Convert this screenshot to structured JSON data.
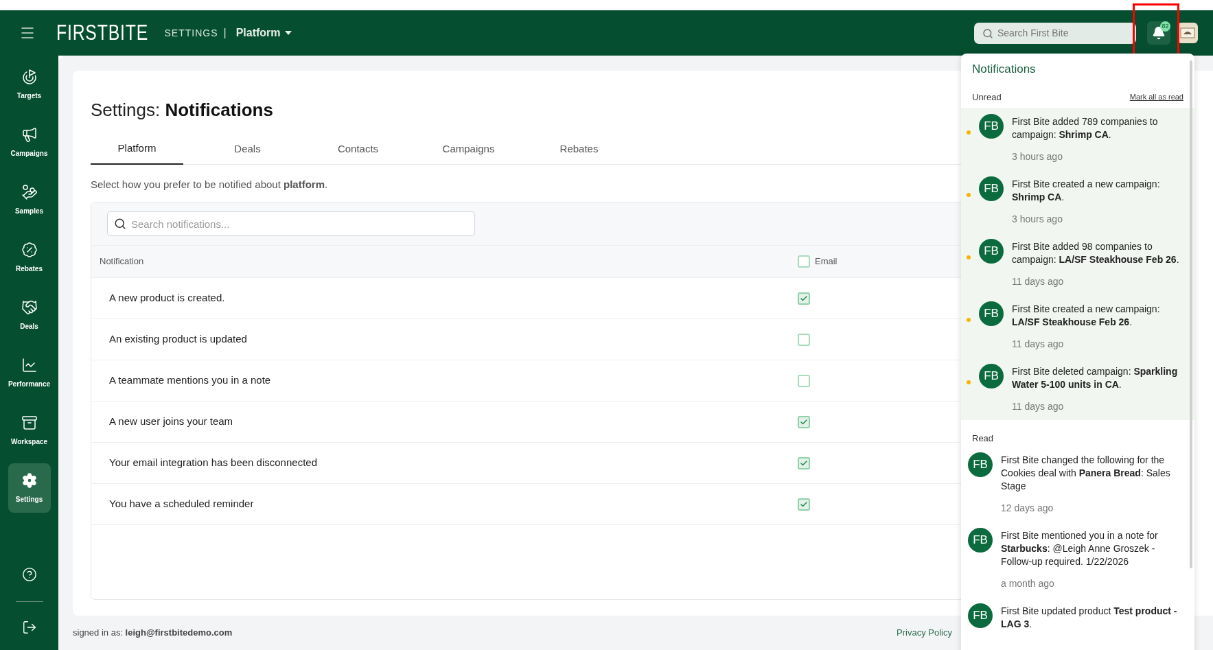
{
  "topbar": {
    "logo": "FIRST**BITE**",
    "section": "SETTINGS",
    "separator": "|",
    "dropdown": "Platform",
    "search": {
      "placeholder": "Search First Bite"
    },
    "badge": "82"
  },
  "sidebar": {
    "items": [
      {
        "label": "Targets",
        "selected": false
      },
      {
        "label": "Campaigns",
        "selected": false
      },
      {
        "label": "Samples",
        "selected": false
      },
      {
        "label": "Rebates",
        "selected": false
      },
      {
        "label": "Deals",
        "selected": false
      },
      {
        "label": "Performance",
        "selected": false
      },
      {
        "label": "Workspace",
        "selected": false
      },
      {
        "label": "Settings",
        "selected": true
      }
    ]
  },
  "page": {
    "title_prefix": "Settings:",
    "title": "Notifications",
    "tabs": [
      {
        "label": "Platform",
        "selected": true
      },
      {
        "label": "Deals",
        "selected": false
      },
      {
        "label": "Contacts",
        "selected": false
      },
      {
        "label": "Campaigns",
        "selected": false
      },
      {
        "label": "Rebates",
        "selected": false
      }
    ],
    "description": "Select how you prefer to be notified about **platform**.",
    "search": {
      "placeholder": "Search notifications..."
    },
    "table": {
      "columns": [
        "Notification",
        "Email"
      ],
      "email_all_checked": false,
      "rows": [
        {
          "label": "A new product is created.",
          "email_checked": true
        },
        {
          "label": "An existing product is updated",
          "email_checked": false
        },
        {
          "label": "A teammate mentions you in a note",
          "email_checked": false
        },
        {
          "label": "A new user joins your team",
          "email_checked": true
        },
        {
          "label": "Your email integration has been disconnected",
          "email_checked": true
        },
        {
          "label": "You have a scheduled reminder",
          "email_checked": true
        }
      ]
    }
  },
  "footer": {
    "signed_in": "signed in as: **leigh@firstbitedemo.com**",
    "privacy": "Privacy Policy"
  },
  "notifications": {
    "title": "Notifications",
    "unread_heading": "Unread",
    "mark_all": "Mark all as read",
    "read_heading": "Read",
    "items": [
      {
        "avatar": "FB",
        "unread": true,
        "text": "First Bite added 789 companies to campaign: **Shrimp CA**.",
        "time": "3 hours ago"
      },
      {
        "avatar": "FB",
        "unread": true,
        "text": "First Bite created a new campaign: **Shrimp CA**.",
        "time": "3 hours ago"
      },
      {
        "avatar": "FB",
        "unread": true,
        "text": "First Bite added 98 companies to campaign: **LA/SF Steakhouse Feb 26**.",
        "time": "11 days ago"
      },
      {
        "avatar": "FB",
        "unread": true,
        "text": "First Bite created a new campaign: **LA/SF Steakhouse Feb 26**.",
        "time": "11 days ago"
      },
      {
        "avatar": "FB",
        "unread": true,
        "text": "First Bite deleted campaign: **Sparkling Water 5-100 units in CA**.",
        "time": "11 days ago"
      },
      {
        "avatar": "FB",
        "unread": false,
        "text": "First Bite changed the following for the Cookies deal with **Panera Bread**: Sales Stage",
        "time": "12 days ago"
      },
      {
        "avatar": "FB",
        "unread": false,
        "text": "First Bite mentioned you in a note for **Starbucks**: @Leigh Anne Groszek - Follow-up required. 1/22/2026",
        "time": "a month ago"
      },
      {
        "avatar": "FB",
        "unread": false,
        "text": "First Bite updated product **Test product - LAG 3**."
      }
    ]
  }
}
